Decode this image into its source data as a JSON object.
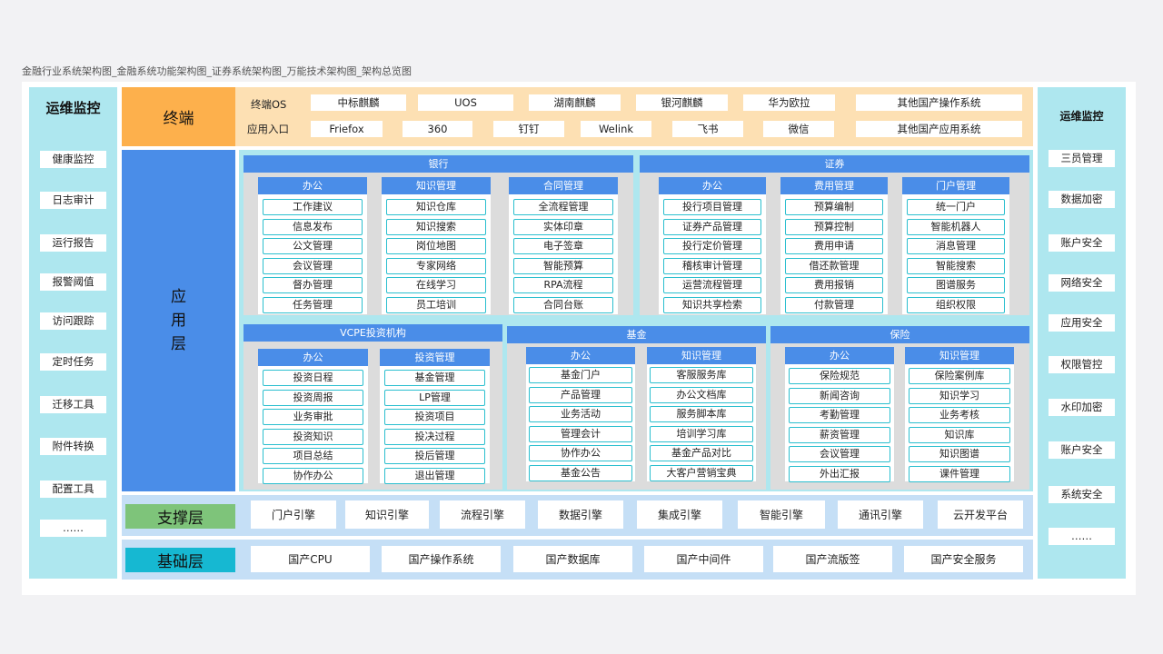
{
  "page_title": "金融行业系统架构图_金融系统功能架构图_证券系统架构图_万能技术架构图_架构总览图",
  "left_sidebar": {
    "title": "运维监控",
    "items": [
      "健康监控",
      "日志审计",
      "运行报告",
      "报警阈值",
      "访问跟踪",
      "定时任务",
      "迁移工具",
      "附件转换",
      "配置工具",
      "……"
    ]
  },
  "right_sidebar": {
    "title": "运维监控",
    "items": [
      "三员管理",
      "数据加密",
      "账户安全",
      "网络安全",
      "应用安全",
      "权限管控",
      "水印加密",
      "账户安全",
      "系统安全",
      "……"
    ]
  },
  "terminal": {
    "label": "终端",
    "os_label": "终端OS",
    "os_items": [
      "中标麒麟",
      "UOS",
      "湖南麒麟",
      "银河麒麟",
      "华为欧拉",
      "其他国产操作系统"
    ],
    "app_label": "应用入口",
    "app_items": [
      "Friefox",
      "360",
      "钉钉",
      "Welink",
      "飞书",
      "微信",
      "其他国产应用系统"
    ]
  },
  "app_layer": {
    "label_chars": [
      "应",
      "用",
      "层"
    ],
    "groups": [
      {
        "title": "银行",
        "columns": [
          {
            "title": "办公",
            "items": [
              "工作建议",
              "信息发布",
              "公文管理",
              "会议管理",
              "督办管理",
              "任务管理"
            ]
          },
          {
            "title": "知识管理",
            "items": [
              "知识仓库",
              "知识搜索",
              "岗位地图",
              "专家网络",
              "在线学习",
              "员工培训"
            ]
          },
          {
            "title": "合同管理",
            "items": [
              "全流程管理",
              "实体印章",
              "电子签章",
              "智能预算",
              "RPA流程",
              "合同台账"
            ]
          }
        ]
      },
      {
        "title": "证券",
        "columns": [
          {
            "title": "办公",
            "items": [
              "投行项目管理",
              "证券产品管理",
              "投行定价管理",
              "稽核审计管理",
              "运营流程管理",
              "知识共享检索"
            ]
          },
          {
            "title": "费用管理",
            "items": [
              "预算编制",
              "预算控制",
              "费用申请",
              "借还款管理",
              "费用报销",
              "付款管理"
            ]
          },
          {
            "title": "门户管理",
            "items": [
              "统一门户",
              "智能机器人",
              "消息管理",
              "智能搜索",
              "图谱服务",
              "组织权限"
            ]
          }
        ]
      },
      {
        "title": "VCPE投资机构",
        "columns": [
          {
            "title": "办公",
            "items": [
              "投资日程",
              "投资周报",
              "业务审批",
              "投资知识",
              "项目总结",
              "协作办公"
            ]
          },
          {
            "title": "投资管理",
            "items": [
              "基金管理",
              "LP管理",
              "投资项目",
              "投决过程",
              "投后管理",
              "退出管理"
            ]
          }
        ]
      },
      {
        "title": "基金",
        "columns": [
          {
            "title": "办公",
            "items": [
              "基金门户",
              "产品管理",
              "业务活动",
              "管理会计",
              "协作办公",
              "基金公告"
            ]
          },
          {
            "title": "知识管理",
            "items": [
              "客服服务库",
              "办公文档库",
              "服务脚本库",
              "培训学习库",
              "基金产品对比",
              "大客户营销宝典"
            ]
          }
        ]
      },
      {
        "title": "保险",
        "columns": [
          {
            "title": "办公",
            "items": [
              "保险规范",
              "新闻咨询",
              "考勤管理",
              "薪资管理",
              "会议管理",
              "外出汇报"
            ]
          },
          {
            "title": "知识管理",
            "items": [
              "保险案例库",
              "知识学习",
              "业务考核",
              "知识库",
              "知识图谱",
              "课件管理"
            ]
          }
        ]
      }
    ]
  },
  "support_layer": {
    "label": "支撑层",
    "items": [
      "门户引擎",
      "知识引擎",
      "流程引擎",
      "数据引擎",
      "集成引擎",
      "智能引擎",
      "通讯引擎",
      "云开发平台"
    ]
  },
  "base_layer": {
    "label": "基础层",
    "items": [
      "国产CPU",
      "国产操作系统",
      "国产数据库",
      "国产中间件",
      "国产流版签",
      "国产安全服务"
    ]
  }
}
